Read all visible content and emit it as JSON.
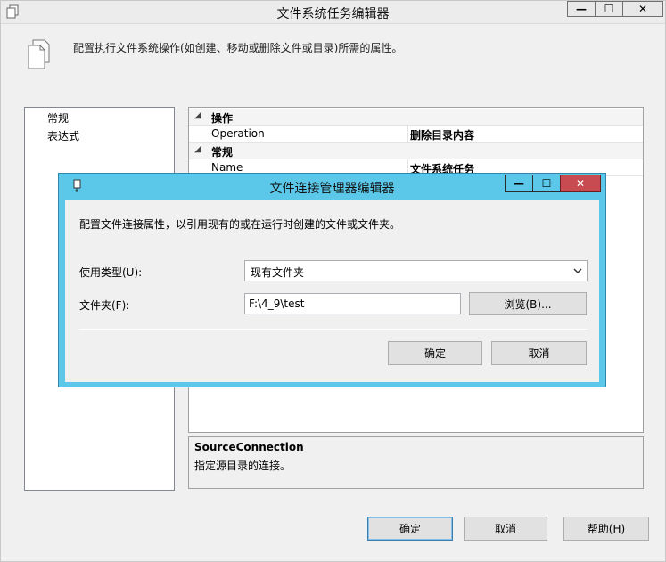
{
  "window": {
    "title": "文件系统任务编辑器",
    "minimize_glyph": "—",
    "maximize_glyph": "☐",
    "close_glyph": "✕",
    "description": "配置执行文件系统操作(如创建、移动或删除文件或目录)所需的属性。"
  },
  "nav": {
    "items": [
      {
        "label": "常规"
      },
      {
        "label": "表达式"
      }
    ]
  },
  "grid": {
    "rows": [
      {
        "toggle": "◢",
        "category": "操作"
      },
      {
        "name": "Operation",
        "value": "删除目录内容"
      },
      {
        "toggle": "◢",
        "category": "常规"
      },
      {
        "name": "Name",
        "value": "文件系统任务"
      }
    ]
  },
  "help": {
    "title": "SourceConnection",
    "description": "指定源目录的连接。"
  },
  "footer": {
    "ok": "确定",
    "cancel": "取消",
    "help": "帮助(H)"
  },
  "dialog": {
    "title": "文件连接管理器编辑器",
    "minimize_glyph": "—",
    "maximize_glyph": "☐",
    "close_glyph": "✕",
    "description": "配置文件连接属性，以引用现有的或在运行时创建的文件或文件夹。",
    "usage_label": "使用类型(U):",
    "usage_value": "现有文件夹",
    "folder_label": "文件夹(F):",
    "folder_value": "F:\\4_9\\test",
    "browse": "浏览(B)...",
    "ok": "确定",
    "cancel": "取消"
  }
}
